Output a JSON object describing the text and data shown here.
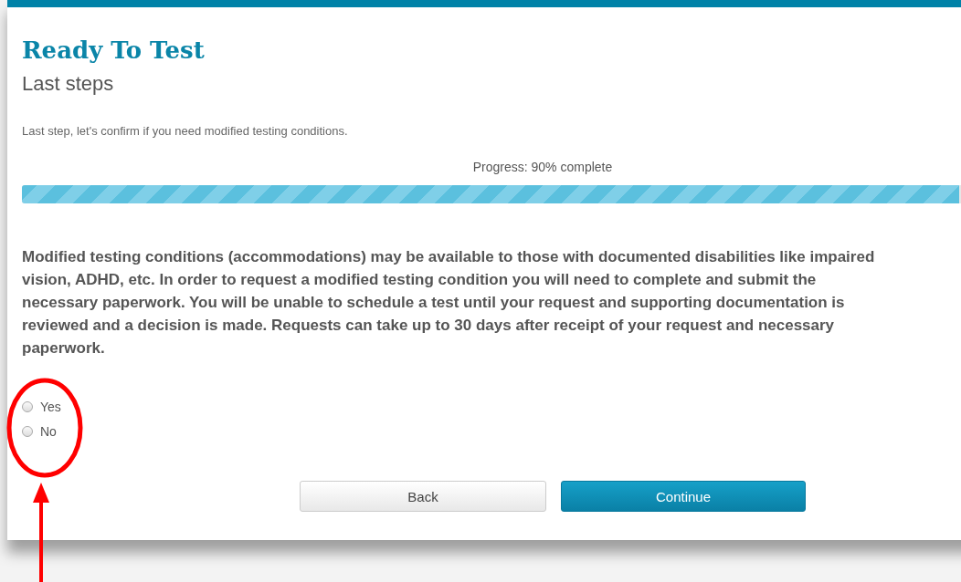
{
  "header": {
    "title": "Ready To Test",
    "subtitle": "Last steps"
  },
  "intro": "Last step, let's confirm if you need modified testing conditions.",
  "progress": {
    "label": "Progress: 90% complete",
    "level": 0.9
  },
  "notice": "Modified testing conditions (accommodations) may be available to those with documented disabilities like impaired vision, ADHD, etc. In order to request a modified testing condition you will need to complete and submit the necessary paperwork. You will be unable to schedule a test until your request and supporting documentation is reviewed and a decision is made. Requests can take up to 30 days after receipt of your request and necessary paperwork.",
  "options": [
    {
      "label": "Yes",
      "selected": false
    },
    {
      "label": "No",
      "selected": false
    }
  ],
  "buttons": [
    {
      "label": "Back",
      "kind": "secondary"
    },
    {
      "label": "Continue",
      "kind": "primary"
    }
  ]
}
